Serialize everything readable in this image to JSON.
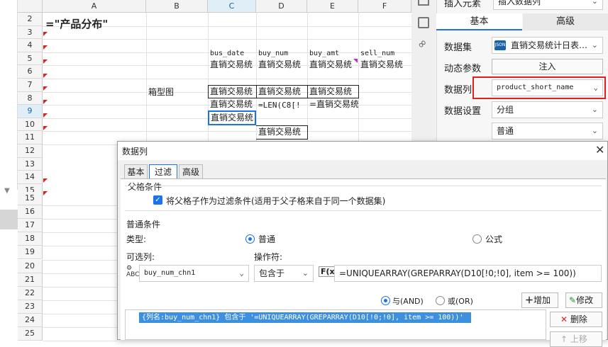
{
  "spreadsheet": {
    "columns": [
      "A",
      "B",
      "C",
      "D",
      "E",
      "F"
    ],
    "selected_column": "C",
    "rows_top": [
      "2",
      "3",
      "4",
      "5",
      "6",
      "7",
      "8",
      "9",
      "10",
      "11",
      "12",
      "13",
      "14",
      "15"
    ],
    "rows_bottom": [
      "15",
      "16",
      "17",
      "18",
      "19",
      "20",
      "21",
      "22",
      "23",
      "24",
      "25"
    ],
    "cells": {
      "a2": "=\"产品分布\"",
      "c4": "bus_date",
      "d4": "buy_num",
      "e4": "buy_amt",
      "f4": "sell_num",
      "c5": "直销交易统",
      "d5": "直销交易统",
      "e5": "直销交易统",
      "f5": "直销交易统",
      "b7": "箱型图",
      "c7": "直销交易统",
      "d7": "直销交易统",
      "e7": "直销交易统",
      "c8": "直销交易统",
      "d8": "=LEN(C8[!",
      "e8": "=直销交易统",
      "c9": "直销交易统",
      "d10": "直销交易统"
    }
  },
  "right_panel": {
    "top_label": "插入元素",
    "top_value": "插入数据列",
    "tab_basic": "基本",
    "tab_advanced": "高级",
    "dataset_label": "数据集",
    "dataset_value": "直销交易统计日表…",
    "dyn_params_label": "动态参数",
    "inject_label": "注入",
    "column_label": "数据列",
    "column_value": "product_short_name",
    "setting_label": "数据设置",
    "setting_value": "分组",
    "setting_sub_value": "普通"
  },
  "dialog": {
    "title": "数据列",
    "tabs": [
      "基本",
      "过滤",
      "高级"
    ],
    "active_tab": "过滤",
    "parent_section": "父格条件",
    "parent_checkbox": "将父格子作为过滤条件(适用于父子格来自于同一个数据集)",
    "normal_section": "普通条件",
    "type_label": "类型:",
    "type_normal": "普通",
    "type_formula": "公式",
    "optional_label": "可选列:",
    "operator_label": "操作符:",
    "column_select": "buy_num_chn1",
    "operator_select": "包含于",
    "fx_label": "F(x)",
    "formula_value": "=UNIQUEARRAY(GREPARRAY(D10[!0;!0], item >= 100))",
    "and_label": "与(AND)",
    "or_label": "或(OR)",
    "add_button": "增加",
    "modify_button": "修改",
    "delete_button": "删除",
    "up_button": "上移",
    "condition_row": "{列名:buy_num_chn1} 包含于 '=UNIQUEARRAY(GREPARRAY(D10[!0;!0], item >= 100))'"
  },
  "colors": {
    "accent": "#1a73e8",
    "highlight_red": "#e02020",
    "condition_bg": "#3d8fe0"
  }
}
